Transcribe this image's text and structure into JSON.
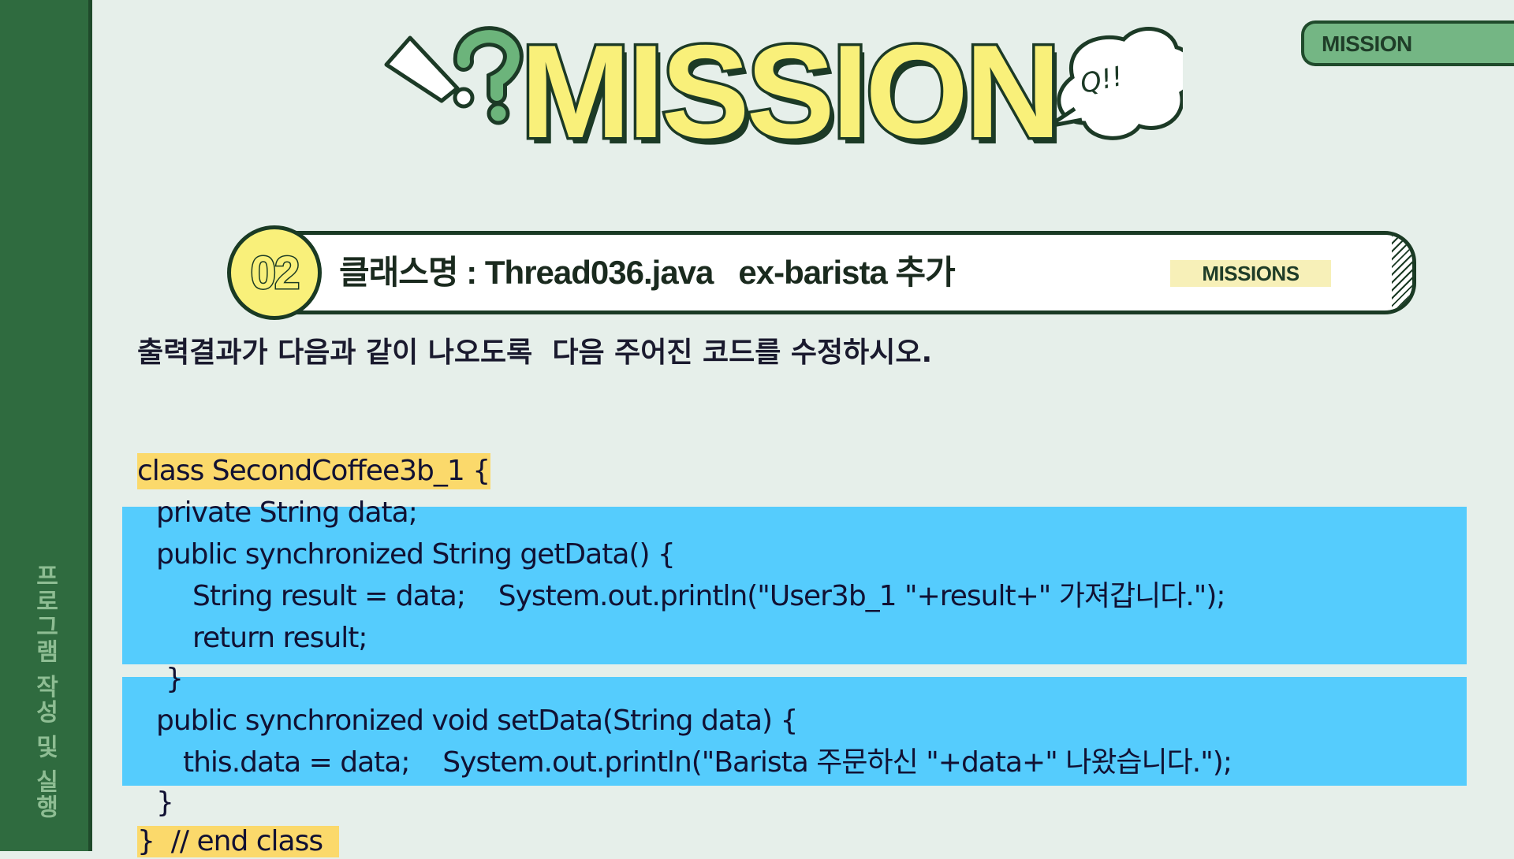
{
  "sidebar": {
    "vertical_label": "프로그램 작성 및 실행"
  },
  "corner_tag": {
    "label": "MISSION"
  },
  "header": {
    "title": "MISSION",
    "bubble_text": "Q!!"
  },
  "mission": {
    "number": "02",
    "heading": "클래스명 : Thread036.java   ex-barista 추가",
    "tag": "MISSIONS"
  },
  "instruction": "출력결과가 다음과 같이 나오도록  다음 주어진 코드를 수정하시오.",
  "code": {
    "lines": [
      "class SecondCoffee3b_1 {",
      "private String data;",
      "public synchronized String getData() {",
      "String result = data;    System.out.println(\"User3b_1 \"+result+\" 가져갑니다.\");",
      "return result;",
      "}",
      "public synchronized void setData(String data) {",
      "this.data = data;    System.out.println(\"Barista 주문하신 \"+data+\" 나왔습니다.\");",
      "}",
      "}  // end class"
    ]
  },
  "colors": {
    "sidebar": "#2f6b3f",
    "background": "#e6efea",
    "title_fill": "#f9f07a",
    "outline": "#1c3a26",
    "highlight_yellow": "#fbd96b",
    "highlight_blue": "#55ccfd"
  }
}
